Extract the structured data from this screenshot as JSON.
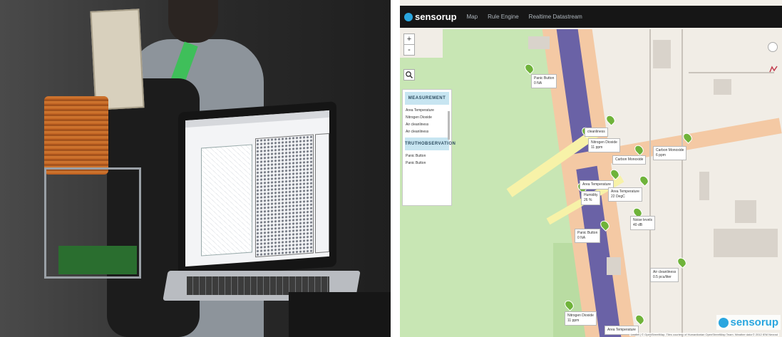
{
  "app": {
    "brand": "sensorup",
    "nav": [
      "Map",
      "Rule Engine",
      "Realtime Datastream"
    ]
  },
  "panel": {
    "measurement_header": "MEASUREMENT",
    "measurement_items": [
      "Area Temperature",
      "Nitrogen Dioxide",
      "Air cleanliness",
      "Air cleanliness"
    ],
    "truth_header": "TRUTHOBSERVATION",
    "truth_items": [
      "Panic Button",
      "Panic Button"
    ]
  },
  "map_labels": [
    {
      "line1": "Panic Button",
      "line2": "0 NA"
    },
    {
      "line1": "cleanliness",
      "line2": ""
    },
    {
      "line1": "Nitrogen Dioxide",
      "line2": "11 ppm"
    },
    {
      "line1": "Carbon Monoxide",
      "line2": ""
    },
    {
      "line1": "Carbon Monoxide",
      "line2": "6 ppm"
    },
    {
      "line1": "Area Temperature",
      "line2": ""
    },
    {
      "line1": "Humidity",
      "line2": "26 %"
    },
    {
      "line1": "Area Temperature",
      "line2": "22 DegC"
    },
    {
      "line1": "Noise levels",
      "line2": "40 dB"
    },
    {
      "line1": "Panic Button",
      "line2": "0 NA"
    },
    {
      "line1": "Air cleanliness",
      "line2": "0.5 pcu/liter"
    },
    {
      "line1": "Nitrogen Dioxide",
      "line2": "11 ppm"
    },
    {
      "line1": "Area Temperature",
      "line2": ""
    }
  ],
  "watermark": "sensorup",
  "attribution": "Leaflet | © OpenStreetMap, Tiles courtesy of Humanitarian OpenStreetMap Team. Weather data © 2012 IEM Nexrad",
  "colors": {
    "accent": "#2aa6df",
    "marker": "#6fb33a",
    "topbar": "#161616"
  }
}
